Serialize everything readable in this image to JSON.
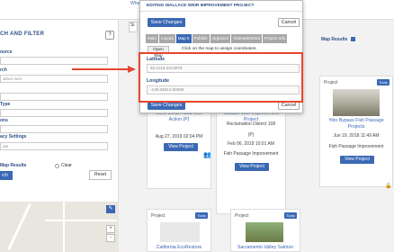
{
  "topbar": {
    "partial_text": "Whe"
  },
  "left_panel": {
    "heading": "CH AND FILTER",
    "help_label": "?",
    "labels": [
      "ource",
      "rch",
      "",
      "Type",
      "ons",
      "acy Settings"
    ],
    "inputs": [
      "",
      "allace weir",
      "",
      "",
      "",
      "",
      "ate"
    ],
    "map_results": "Map Results",
    "clear_label": "Clear",
    "search_label": "rch",
    "reset_label": "Reset",
    "map_controls": [
      "+",
      "-"
    ]
  },
  "main": {
    "map_tab": "Si",
    "map_results_label": "Map Results"
  },
  "cards": [
    {
      "title": "North Delta Flood Weir Action (P)",
      "date": "Aug 27, 2019 02:04 PM",
      "button": "View Project"
    },
    {
      "title": "Wallace Weir Improvement Project",
      "lines": [
        "Reclamation District 108",
        "(P)",
        "Feb 06, 2019 10:01 AM",
        "Fish Passage Improvement"
      ],
      "button": "View Project"
    },
    {
      "project_label": "Project",
      "tools_label": "Tools",
      "title": "Yolo Bypass Fish Passage Projects",
      "date": "Jun 19, 2018 11:49 AM",
      "category": "Fish Passage Improvement",
      "button": "View Project"
    },
    {
      "project_label": "Project",
      "tools_label": "Tools",
      "title": "California EcoRestore"
    },
    {
      "project_label": "Project",
      "tools_label": "Tools",
      "title": "Sacramento Valley Salmon"
    }
  ],
  "dialog": {
    "title": "EDITING WALLACE WEIR IMPROVEMENT PROJECT",
    "save_label": "Save Changes",
    "cancel_label": "Cancel",
    "tabs": [
      "Main",
      "Layout",
      "Map It",
      "Publish",
      "Organize",
      "Videos/Embed",
      "Project Info"
    ],
    "active_tab": "Map It",
    "open_map_label": "Open Map",
    "instruction": "Click on the map to assign coordinates.",
    "latitude_label": "Latitude",
    "latitude_value": "40.1143.3213076",
    "longitude_label": "Longitude",
    "longitude_value": "-139.63612.82096",
    "save_label_bottom": "Save Changes",
    "cancel_label_bottom": "Cancel"
  },
  "colors": {
    "accent": "#3a68b5",
    "highlight": "#e8452c",
    "heading": "#2d4f86"
  }
}
